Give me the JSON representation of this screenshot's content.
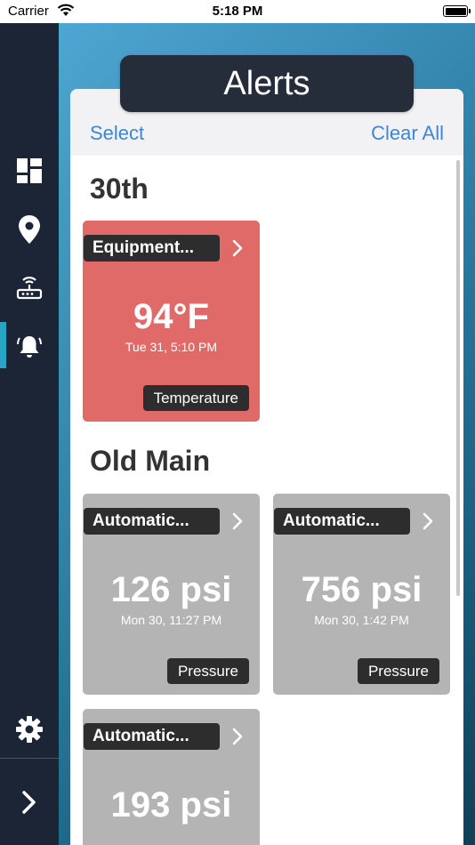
{
  "status_bar": {
    "carrier": "Carrier",
    "time": "5:18 PM"
  },
  "sidebar": {
    "items": [
      {
        "icon": "dashboard-icon"
      },
      {
        "icon": "location-pin-icon"
      },
      {
        "icon": "router-icon"
      },
      {
        "icon": "bell-icon",
        "active": true
      },
      {
        "icon": "gear-icon"
      },
      {
        "icon": "chevron-right-icon"
      }
    ],
    "accent_color": "#2aa4c5"
  },
  "header": {
    "title": "Alerts",
    "select_label": "Select",
    "clear_all_label": "Clear All"
  },
  "sections": [
    {
      "title": "30th",
      "alerts": [
        {
          "name": "Equipment...",
          "value": "94°F",
          "timestamp": "Tue 31, 5:10 PM",
          "type": "Temperature",
          "color": "#e06a68"
        }
      ]
    },
    {
      "title": "Old Main",
      "alerts": [
        {
          "name": "Automatic...",
          "value": "126 psi",
          "timestamp": "Mon 30, 11:27 PM",
          "type": "Pressure",
          "color": "#b4b4b4"
        },
        {
          "name": "Automatic...",
          "value": "756 psi",
          "timestamp": "Mon 30, 1:42 PM",
          "type": "Pressure",
          "color": "#b4b4b4"
        },
        {
          "name": "Automatic...",
          "value": "193 psi",
          "timestamp": "",
          "type": "",
          "color": "#b4b4b4"
        }
      ]
    }
  ]
}
